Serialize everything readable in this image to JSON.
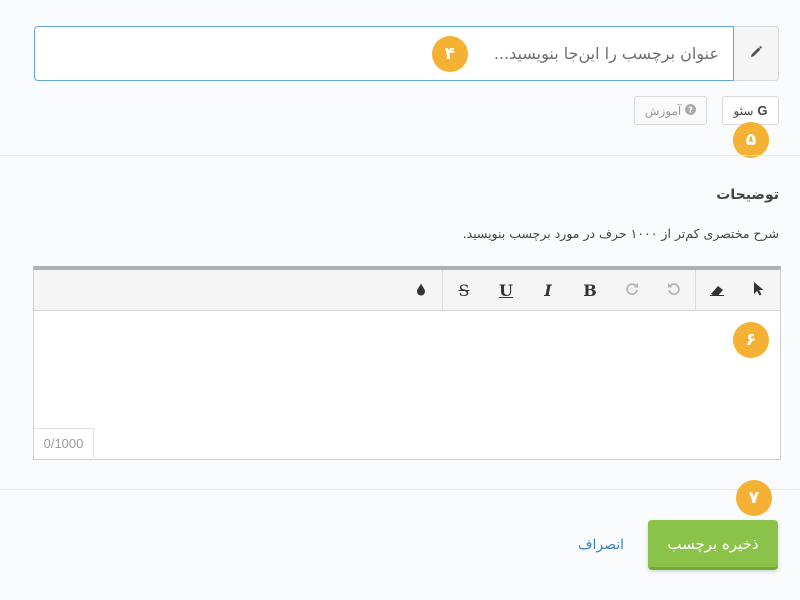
{
  "title_field": {
    "placeholder": "عنوان برچسب را این‌جا بنویسید..."
  },
  "badges": {
    "step4": "۴",
    "step5": "۵",
    "step6": "۶",
    "step7": "۷"
  },
  "seo_button": {
    "icon_text": "G",
    "label": "سئو"
  },
  "help_button": {
    "label": "آموزش"
  },
  "description": {
    "title": "توضیحات",
    "hint": "شرح مختصری کم‌تر از ۱۰۰۰ حرف در مورد برچسب بنویسید."
  },
  "editor": {
    "bold": "B",
    "italic": "I",
    "underline": "U",
    "strike": "S",
    "counter": "0/1000"
  },
  "footer": {
    "save_label": "ذخیره برچسب",
    "cancel_label": "انصراف"
  },
  "colors": {
    "accent_badge": "#f5b134",
    "save_green": "#8bc34a",
    "link_blue": "#3d7fbf",
    "input_focus": "#66a7d9"
  }
}
